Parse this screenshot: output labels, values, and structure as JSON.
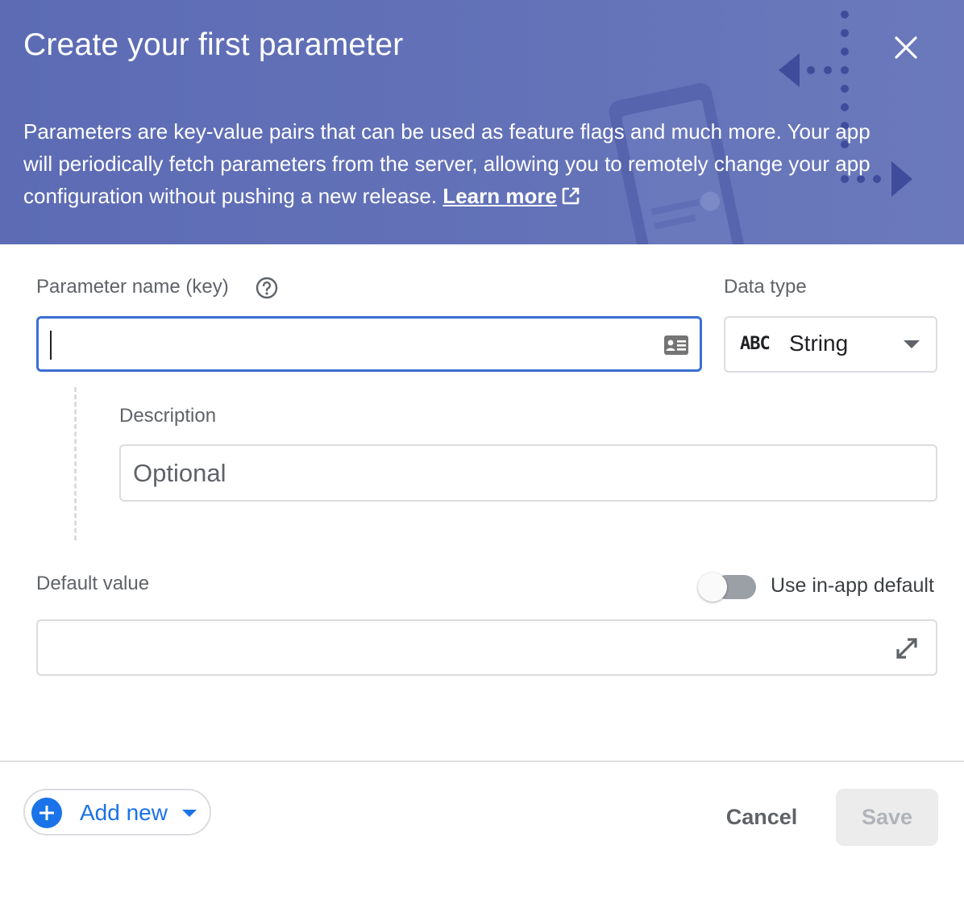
{
  "header": {
    "title": "Create your first parameter",
    "description": "Parameters are key-value pairs that can be used as feature flags and much more. Your app will periodically fetch parameters from the server, allowing you to remotely change your app configuration without pushing a new release.",
    "learn_more_label": "Learn more",
    "close_icon": "close-icon",
    "background_color": "#5f6eb6"
  },
  "form": {
    "key": {
      "label": "Parameter name (key)",
      "value": "",
      "help_icon": "help-circle-icon",
      "suffix_icon": "contact-card-icon"
    },
    "data_type": {
      "label": "Data type",
      "value": "String",
      "type_icon_text": "ABC",
      "dropdown_icon": "caret-down-icon"
    },
    "description": {
      "label": "Description",
      "placeholder": "Optional",
      "value": ""
    },
    "default_value": {
      "label": "Default value",
      "value": "",
      "toggle_label": "Use in-app default",
      "toggle_on": false,
      "expand_icon": "expand-icon"
    }
  },
  "footer": {
    "add_new_label": "Add new",
    "add_icon": "plus-circle-icon",
    "cancel_label": "Cancel",
    "save_label": "Save",
    "save_enabled": false
  },
  "colors": {
    "accent": "#1a73e8",
    "focus_border": "#3b6fd3"
  }
}
